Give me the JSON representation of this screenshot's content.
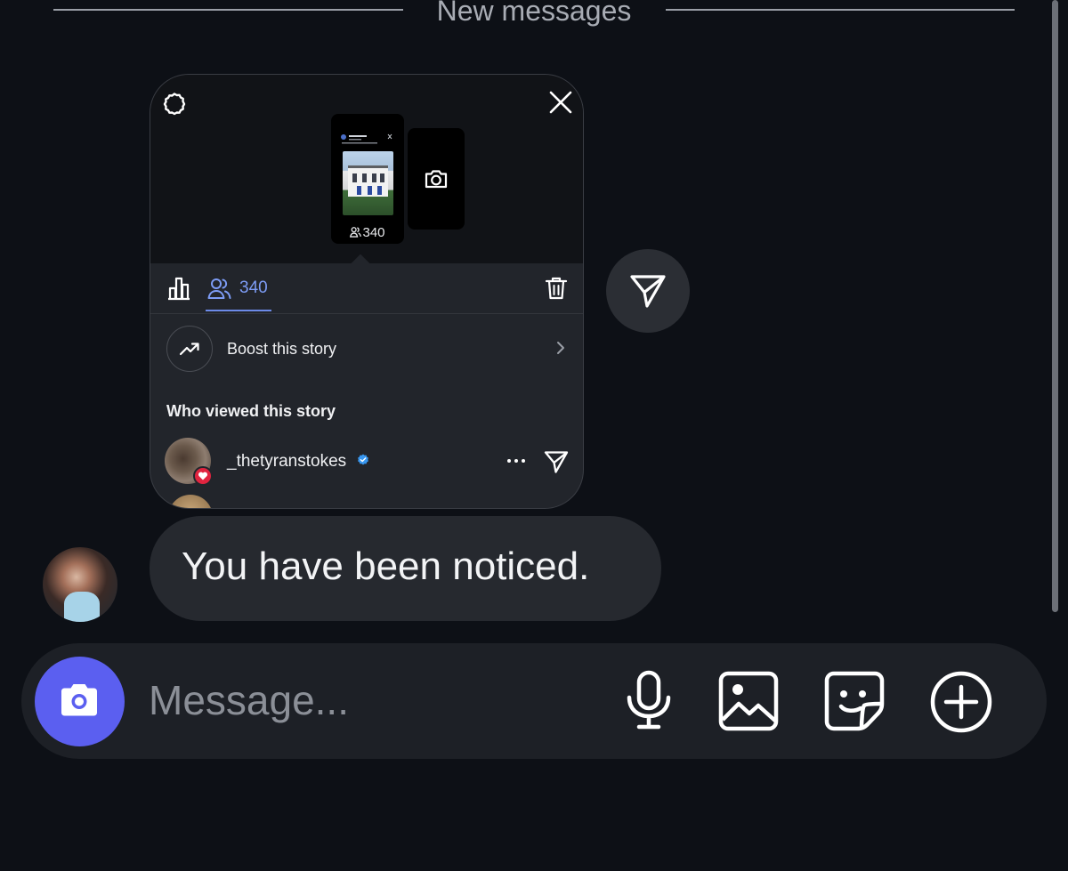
{
  "divider": {
    "label": "New messages"
  },
  "story": {
    "thumbnail_viewer_count": "340",
    "viewers_count": "340",
    "boost_label": "Boost this story",
    "viewers_title": "Who viewed this story",
    "viewers": [
      {
        "username": "_thetyranstokes",
        "verified": true,
        "reaction": "heart"
      }
    ]
  },
  "message": {
    "text": "You have been noticed."
  },
  "composer": {
    "placeholder": "Message..."
  },
  "colors": {
    "accent": "#5b5ff0",
    "link": "#7d9cf5",
    "background": "#0d1016",
    "bubble": "#26292f",
    "heart": "#e0243f"
  },
  "icons": [
    "settings-icon",
    "close-icon",
    "camera-icon",
    "bar-chart-icon",
    "people-icon",
    "trash-icon",
    "trending-up-icon",
    "chevron-right-icon",
    "verified-icon",
    "more-icon",
    "send-icon",
    "microphone-icon",
    "gallery-icon",
    "sticker-icon",
    "add-icon"
  ]
}
